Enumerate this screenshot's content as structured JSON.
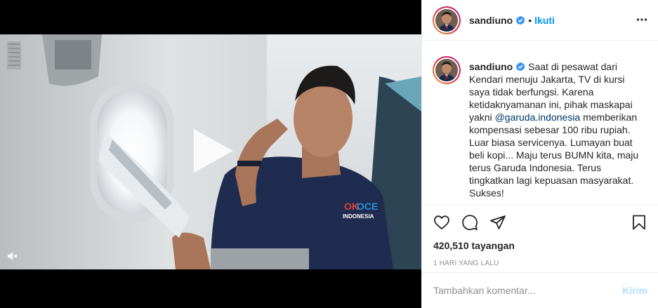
{
  "post": {
    "username": "sandiuno",
    "separator": "•",
    "follow_label": "Ikuti",
    "caption_before": "Saat di pesawat dari Kendari menuju Jakarta, TV di kursi saya tidak berfungsi. Karena ketidaknyamanan ini, pihak maskapai yakni ",
    "mention": "@garuda.indonesia",
    "caption_after": " memberikan kompensasi sebesar 100 ribu rupiah. Luar biasa servicenya. Lumayan buat beli kopi... Maju terus BUMN kita, maju terus Garuda Indonesia. Terus tingkatkan lagi kepuasan masyarakat. Sukses!",
    "views": "420,510 tayangan",
    "timestamp": "1 HARI YANG LALU"
  },
  "comment": {
    "placeholder": "Tambahkan komentar...",
    "post_label": "Kirim"
  },
  "icons": {
    "more": "more-options-icon",
    "like": "heart-icon",
    "comment": "comment-icon",
    "share": "share-icon",
    "save": "bookmark-icon",
    "play": "play-icon",
    "mute": "audio-muted-icon",
    "verified": "verified-badge-icon"
  },
  "colors": {
    "accent_blue": "#0095f6",
    "mention_blue": "#00376b",
    "verified_blue": "#3897f0",
    "post_disabled": "#b2dffc",
    "muted_text": "#8e8e8e"
  }
}
